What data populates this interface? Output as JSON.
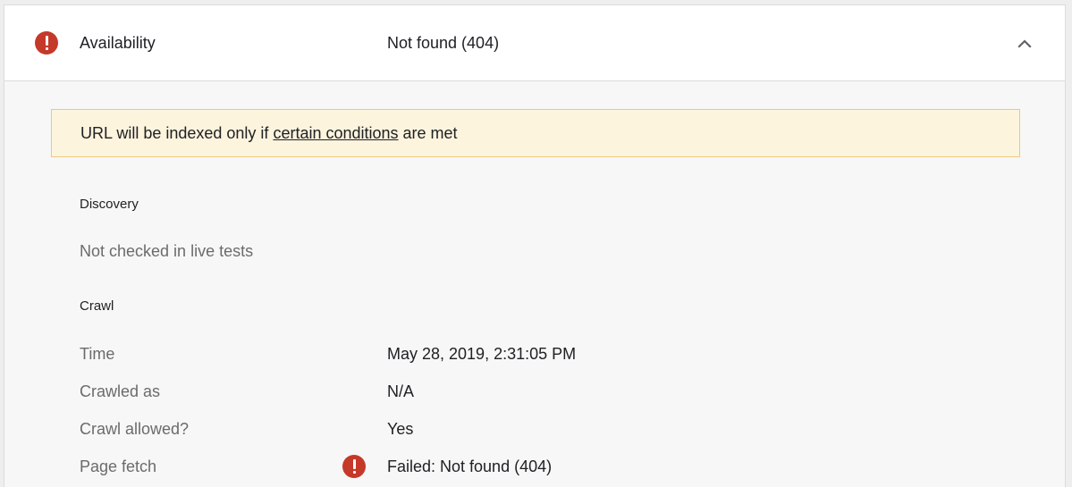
{
  "header": {
    "label": "Availability",
    "value": "Not found (404)",
    "status_icon": "error-icon",
    "toggle_icon": "chevron-up-icon",
    "error_color": "#c5392a"
  },
  "banner": {
    "text_before": "URL will be indexed only if ",
    "link_text": "certain conditions",
    "text_after": " are met",
    "background_color": "#fdf4de",
    "border_color": "#eacb7a"
  },
  "discovery": {
    "title": "Discovery",
    "message": "Not checked in live tests"
  },
  "crawl": {
    "title": "Crawl",
    "rows": [
      {
        "label": "Time",
        "value": "May 28, 2019, 2:31:05 PM"
      },
      {
        "label": "Crawled as",
        "value": "N/A"
      },
      {
        "label": "Crawl allowed?",
        "value": "Yes"
      },
      {
        "label": "Page fetch",
        "value": "Failed: Not found (404)",
        "status_icon": "error-icon"
      }
    ]
  }
}
